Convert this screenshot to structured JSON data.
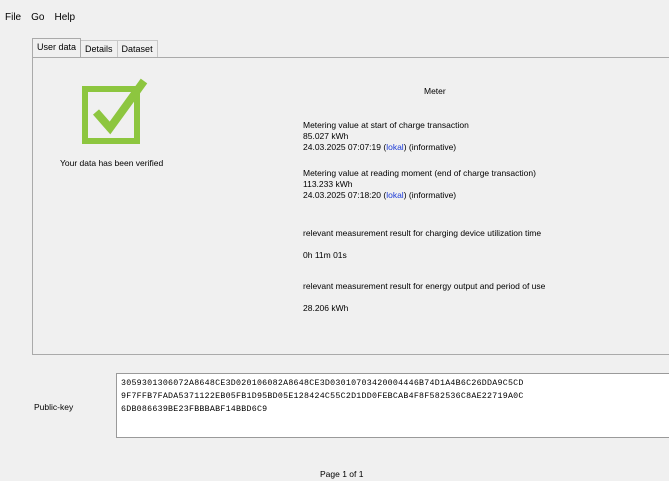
{
  "menu": {
    "file": "File",
    "go": "Go",
    "help": "Help"
  },
  "tabs": [
    {
      "label": "User data"
    },
    {
      "label": "Details"
    },
    {
      "label": "Dataset"
    }
  ],
  "verification": {
    "icon": "checkmark-icon",
    "color": "#8dc63f",
    "text": "Your data has been verified"
  },
  "meter": {
    "title": "Meter",
    "start_label": "Metering value at start of charge transaction",
    "start_value": "85.027 kWh",
    "start_time": "24.03.2025 07:07:19",
    "start_lokal": "lokal",
    "start_informative": "(informative)",
    "reading_label": "Metering value at reading moment (end of charge transaction)",
    "reading_value": "113.233 kWh",
    "reading_time": "24.03.2025 07:18:20",
    "reading_lokal": "lokal",
    "reading_informative": "(informative)",
    "duration_label": "relevant measurement result for charging device utilization time",
    "duration_value": "0h 11m 01s",
    "energy_label": "relevant measurement result for energy output and period of use",
    "energy_value": "28.206 kWh"
  },
  "public_key": {
    "label": "Public-key",
    "line1": "3059301306072A8648CE3D020106082A8648CE3D03010703420004446B74D1A4B6C26DDA9C5CD",
    "line2": "9F7FFB7FADA5371122EB05FB1D95BD05E128424C55C2D1DD0FEBCAB4F8F582536C8AE22719A0C",
    "line3": "6DB086639BE23FBBBABF14BBD6C9"
  },
  "pager": {
    "text": "Page 1 of 1"
  }
}
